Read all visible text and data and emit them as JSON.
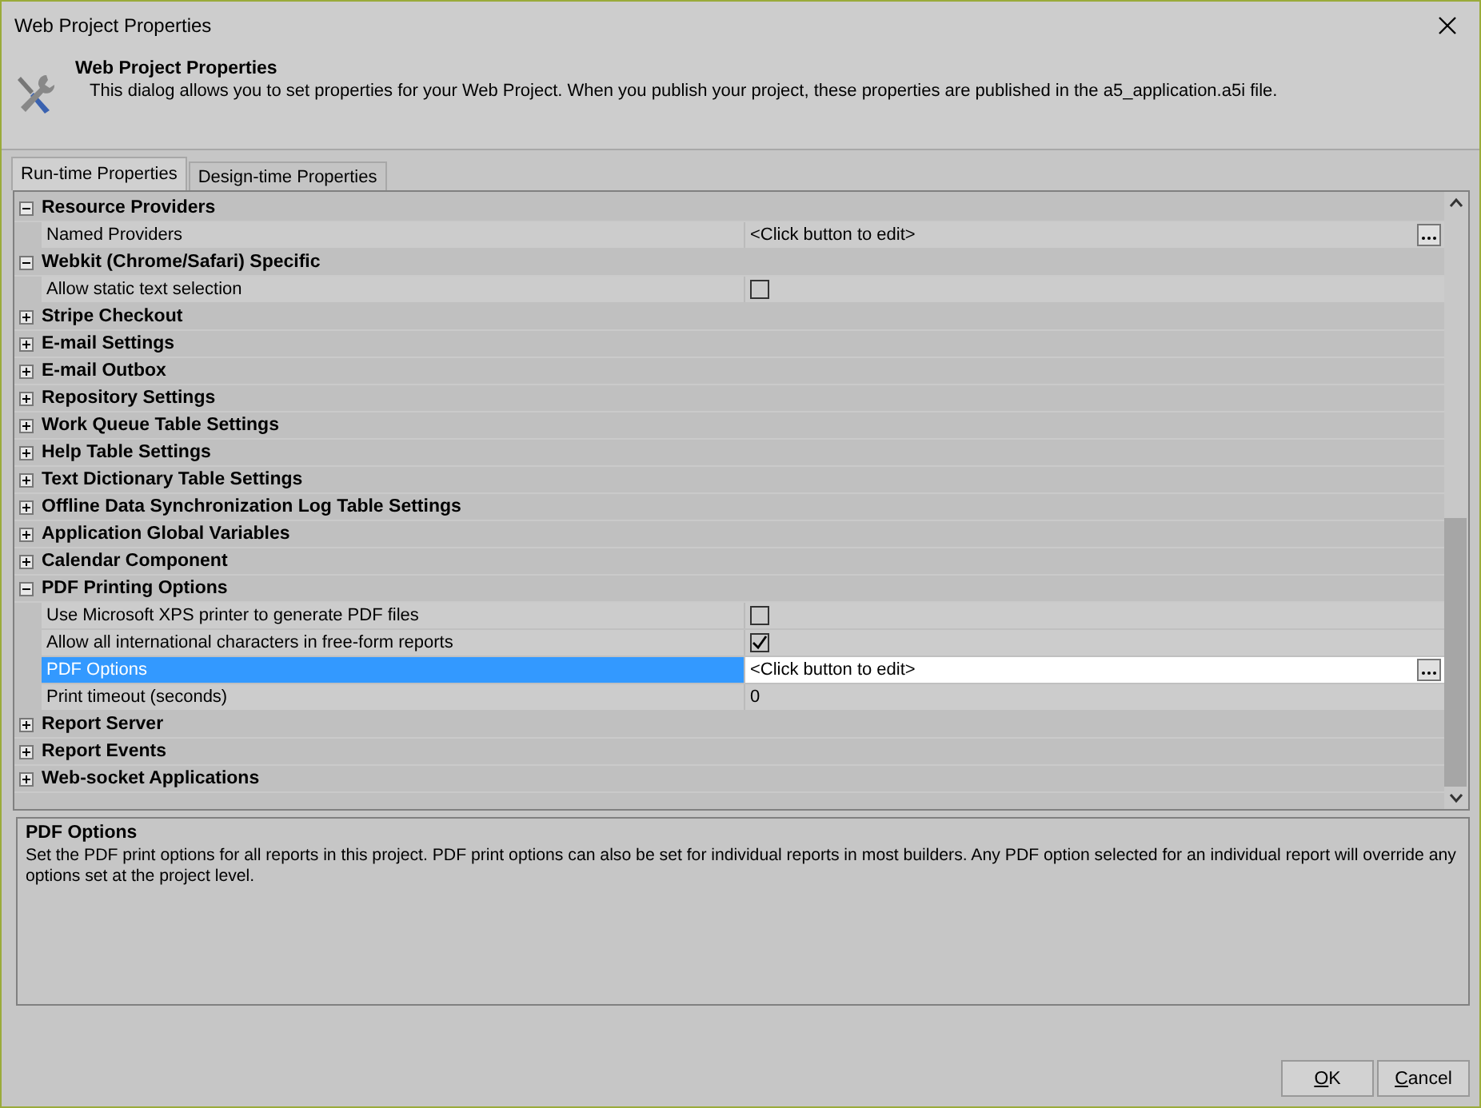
{
  "window": {
    "title": "Web Project Properties"
  },
  "header": {
    "title": "Web Project Properties",
    "description": "This dialog allows you to set properties for your Web Project. When you publish your project, these properties are published in the a5_application.a5i file."
  },
  "tabs": [
    {
      "label": "Run-time Properties",
      "selected": true
    },
    {
      "label": "Design-time Properties",
      "selected": false
    }
  ],
  "categories": [
    {
      "name": "Resource Providers",
      "expanded": true,
      "properties": [
        {
          "name": "Named Providers",
          "kind": "button",
          "value": "<Click button to edit>",
          "selected": false
        }
      ]
    },
    {
      "name": "Webkit (Chrome/Safari) Specific",
      "expanded": true,
      "properties": [
        {
          "name": "Allow static text selection",
          "kind": "checkbox",
          "checked": false,
          "selected": false
        }
      ]
    },
    {
      "name": "Stripe Checkout",
      "expanded": false
    },
    {
      "name": "E-mail Settings",
      "expanded": false
    },
    {
      "name": "E-mail Outbox",
      "expanded": false
    },
    {
      "name": "Repository Settings",
      "expanded": false
    },
    {
      "name": "Work Queue Table Settings",
      "expanded": false
    },
    {
      "name": "Help Table Settings",
      "expanded": false
    },
    {
      "name": "Text Dictionary Table Settings",
      "expanded": false
    },
    {
      "name": "Offline Data Synchronization Log Table Settings",
      "expanded": false
    },
    {
      "name": "Application Global Variables",
      "expanded": false
    },
    {
      "name": "Calendar Component",
      "expanded": false
    },
    {
      "name": "PDF Printing Options",
      "expanded": true,
      "properties": [
        {
          "name": "Use Microsoft XPS printer to generate PDF files",
          "kind": "checkbox",
          "checked": false,
          "selected": false
        },
        {
          "name": "Allow all international characters in free-form reports",
          "kind": "checkbox",
          "checked": true,
          "selected": false
        },
        {
          "name": "PDF Options",
          "kind": "button",
          "value": "<Click button to edit>",
          "selected": true
        },
        {
          "name": "Print timeout (seconds)",
          "kind": "text",
          "value": "0",
          "selected": false
        }
      ]
    },
    {
      "name": "Report Server",
      "expanded": false
    },
    {
      "name": "Report Events",
      "expanded": false
    },
    {
      "name": "Web-socket Applications",
      "expanded": false
    }
  ],
  "description_panel": {
    "title": "PDF Options",
    "text": "Set the PDF print options for all reports in this project. PDF print options can also be set for individual reports in most builders.  Any PDF option selected for an individual report will override any options set at the project level."
  },
  "buttons": [
    {
      "label": "OK"
    },
    {
      "label": "Cancel"
    }
  ]
}
